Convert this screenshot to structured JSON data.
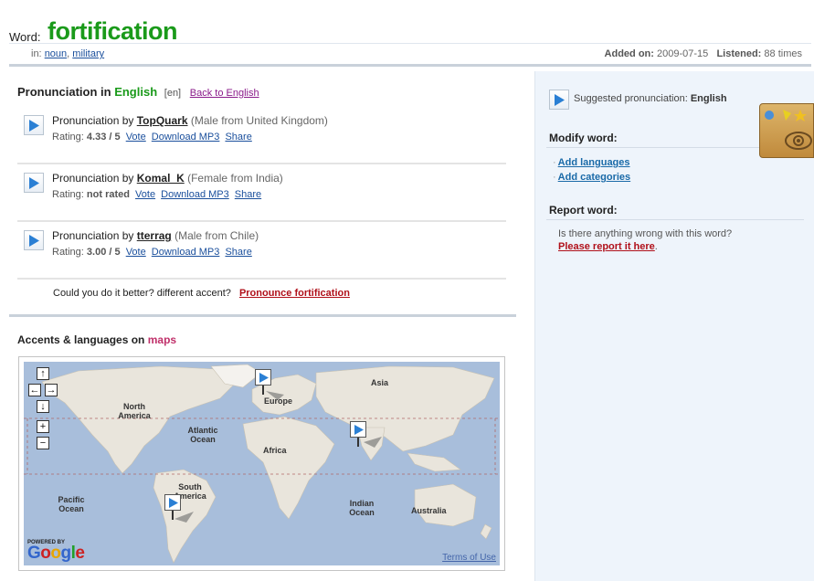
{
  "header": {
    "word_label": "Word:",
    "word": "fortification",
    "in_label": "in:",
    "tags": [
      "noun",
      "military"
    ],
    "added_label": "Added on:",
    "added_value": "2009-07-15",
    "listened_label": "Listened:",
    "listened_value": "88 times"
  },
  "pronunciation_section": {
    "title_prefix": "Pronunciation in",
    "language": "English",
    "language_code": "[en]",
    "back_link": "Back to English"
  },
  "pronunciations": [
    {
      "prefix": "Pronunciation by",
      "user": "TopQuark",
      "desc": "(Male from United Kingdom)",
      "rating_label": "Rating:",
      "rating": "4.33",
      "rating_scale": "/ 5",
      "vote": "Vote",
      "download": "Download MP3",
      "share": "Share"
    },
    {
      "prefix": "Pronunciation by",
      "user": "Komal_K",
      "desc": "(Female from India)",
      "rating_label": "Rating:",
      "rating": "not rated",
      "rating_scale": "",
      "vote": "Vote",
      "download": "Download MP3",
      "share": "Share"
    },
    {
      "prefix": "Pronunciation by",
      "user": "tterrag",
      "desc": "(Male from Chile)",
      "rating_label": "Rating:",
      "rating": "3.00",
      "rating_scale": "/ 5",
      "vote": "Vote",
      "download": "Download MP3",
      "share": "Share"
    }
  ],
  "better": {
    "question": "Could you do it better? different accent?",
    "link": "Pronounce fortification"
  },
  "maps": {
    "title_prefix": "Accents & languages on",
    "title_highlight": "maps",
    "labels": {
      "north_america": "North America",
      "europe": "Europe",
      "asia": "Asia",
      "atlantic": "Atlantic Ocean",
      "africa": "Africa",
      "pacific": "Pacific Ocean",
      "south_america": "South America",
      "indian": "Indian Ocean",
      "australia": "Australia"
    },
    "powered_by": "POWERED BY",
    "google": "Google",
    "terms": "Terms of Use"
  },
  "sidebar": {
    "suggested_label": "Suggested pronunciation:",
    "suggested_lang": "English",
    "modify_title": "Modify word:",
    "add_languages": "Add languages",
    "add_categories": "Add categories",
    "report_title": "Report word:",
    "report_question": "Is there anything wrong with this word?",
    "report_link": "Please report it here"
  },
  "colors": {
    "word_green": "#1a9a1a",
    "accent_red": "#b0101a",
    "maps_pink": "#c0306a",
    "sidebar_bg": "#eef4fb"
  }
}
